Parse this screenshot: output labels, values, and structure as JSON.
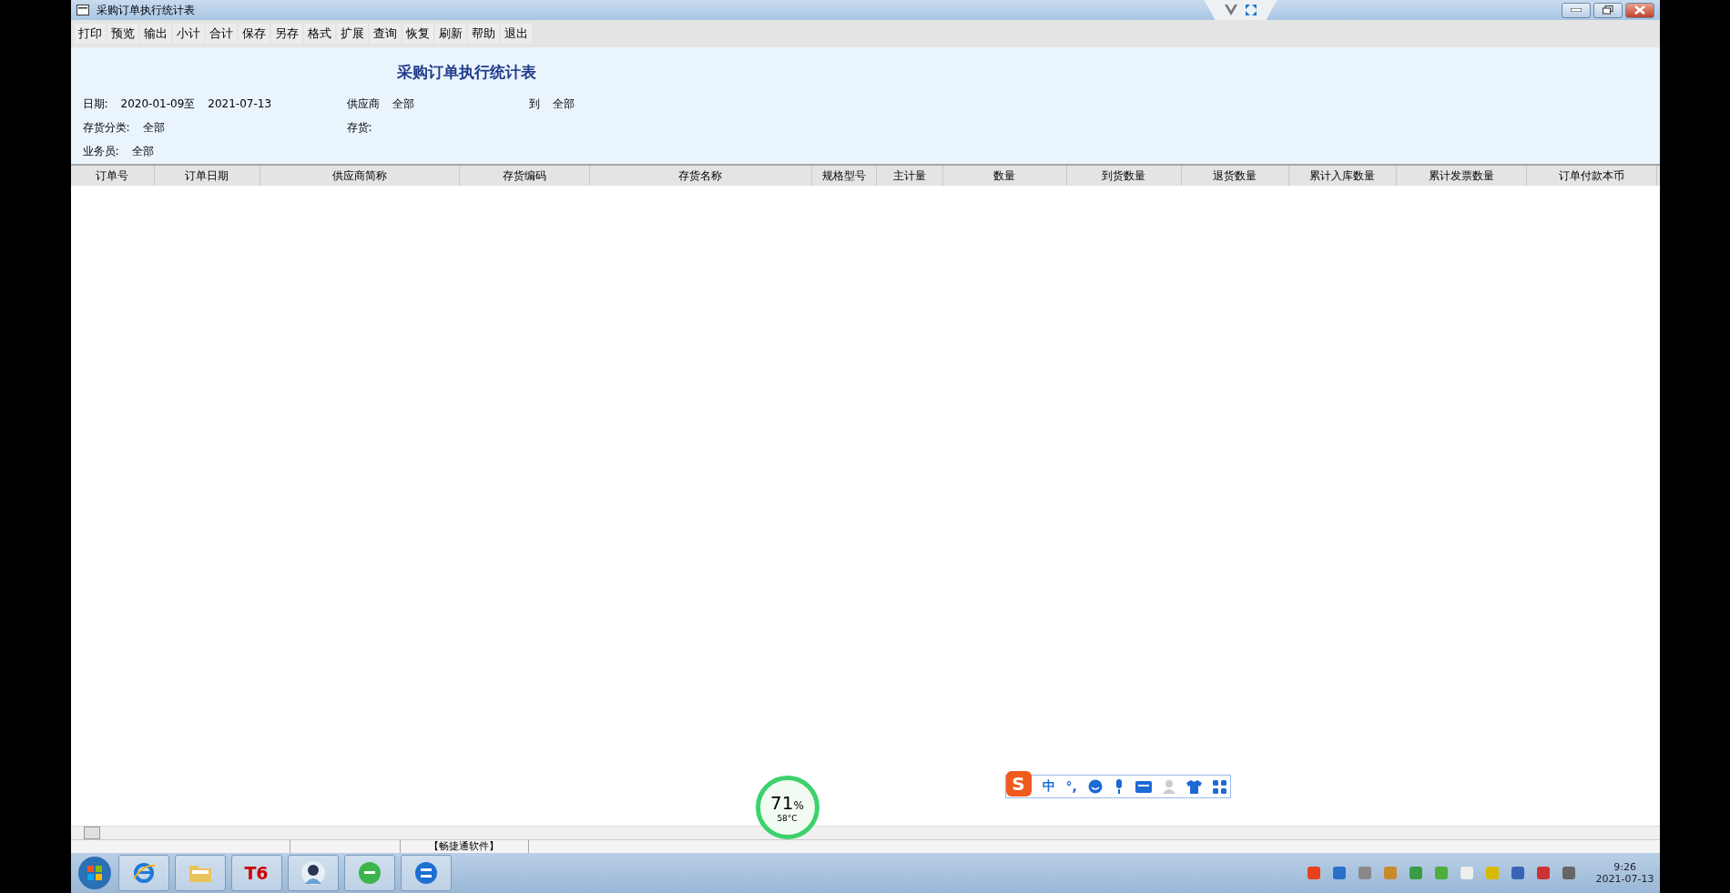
{
  "window": {
    "title": "采购订单执行统计表"
  },
  "toolbar": [
    "打印",
    "预览",
    "输出",
    "小计",
    "合计",
    "保存",
    "另存",
    "格式",
    "扩展",
    "查询",
    "恢复",
    "刷新",
    "帮助",
    "退出"
  ],
  "report": {
    "title": "采购订单执行统计表",
    "filter_rows": [
      [
        {
          "label": "日期:",
          "values": [
            "2020-01-09至",
            "2021-07-13"
          ]
        },
        {
          "label": "供应商",
          "values": [
            "全部"
          ]
        },
        {
          "label": "到",
          "values": [
            "全部"
          ]
        }
      ],
      [
        {
          "label": "存货分类:",
          "values": [
            "全部"
          ]
        },
        {
          "label": "存货:"
        }
      ],
      [
        {
          "label": "业务员:",
          "values": [
            "全部"
          ]
        }
      ]
    ]
  },
  "table": {
    "columns": [
      "订单号",
      "订单日期",
      "供应商简称",
      "存货编码",
      "存货名称",
      "规格型号",
      "主计量",
      "数量",
      "到货数量",
      "退货数量",
      "累计入库数量",
      "累计发票数量",
      "订单付款本币"
    ]
  },
  "status_bar": [
    "【畅捷通软件】"
  ],
  "monitor": {
    "percent": "71",
    "unit": "%",
    "temperature": "58°C"
  },
  "ime_bar": {
    "logo": "S",
    "mode": "中",
    "punct": "°,"
  },
  "taskbar": {
    "apps": [
      {
        "kind": "ie"
      },
      {
        "kind": "folder"
      },
      {
        "kind": "text",
        "label": "T6"
      },
      {
        "kind": "person"
      },
      {
        "kind": "green-e"
      },
      {
        "kind": "blue-e"
      }
    ],
    "clock": {
      "time": "9:26",
      "date": "2021-07-13"
    }
  }
}
